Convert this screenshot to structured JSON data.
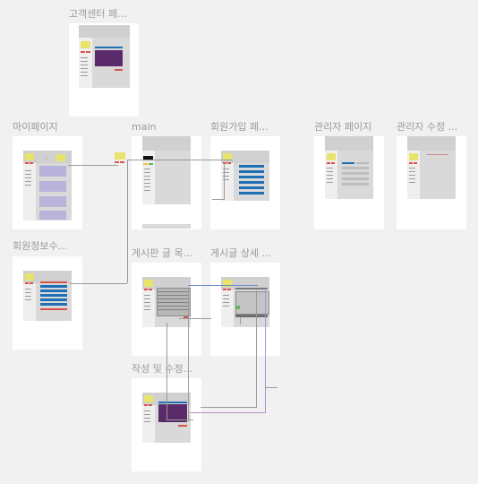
{
  "canvas": {
    "frames": [
      {
        "id": "customer-center",
        "title": "고객센터 페..."
      },
      {
        "id": "mypage",
        "title": "마이페이지"
      },
      {
        "id": "main",
        "title": "main"
      },
      {
        "id": "signup",
        "title": "회원가입 페..."
      },
      {
        "id": "admin",
        "title": "관리자 페이지"
      },
      {
        "id": "admin-edit",
        "title": "관리자 수정 ..."
      },
      {
        "id": "member-edit",
        "title": "회원정보수..."
      },
      {
        "id": "board-list",
        "title": "게시판 글 목..."
      },
      {
        "id": "post-detail",
        "title": "게시글 상세 ..."
      },
      {
        "id": "write-edit",
        "title": "작성 및 수정..."
      }
    ]
  },
  "colors": {
    "canvas_bg": "#f1f1f1",
    "frame_bg": "#ffffff",
    "screen_bg": "#d9d9d9",
    "accent_yellow": "#e8e36a",
    "accent_red": "#d9534f",
    "accent_blue": "#1f6fb5",
    "accent_purple": "#5a2a6a",
    "accent_lavender": "#b9b3dc"
  }
}
